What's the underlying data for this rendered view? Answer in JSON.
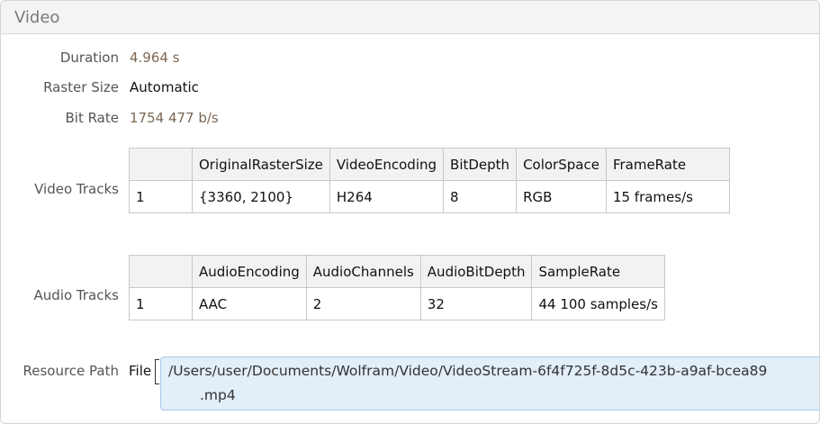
{
  "header": {
    "title": "Video"
  },
  "properties": {
    "duration": {
      "label": "Duration",
      "value": "4.964 s"
    },
    "raster_size": {
      "label": "Raster Size",
      "value": "Automatic"
    },
    "bit_rate": {
      "label": "Bit Rate",
      "value": "1754 477 b/s"
    }
  },
  "video_tracks": {
    "label": "Video Tracks",
    "columns": [
      "",
      "OriginalRasterSize",
      "VideoEncoding",
      "BitDepth",
      "ColorSpace",
      "FrameRate"
    ],
    "rows": [
      [
        "1",
        "{3360, 2100}",
        "H264",
        "8",
        "RGB",
        "15 frames/s"
      ]
    ]
  },
  "audio_tracks": {
    "label": "Audio Tracks",
    "columns": [
      "",
      "AudioEncoding",
      "AudioChannels",
      "AudioBitDepth",
      "SampleRate"
    ],
    "rows": [
      [
        "1",
        "AAC",
        "2",
        "32",
        "44 100 samples/s"
      ]
    ]
  },
  "resource_path": {
    "label": "Resource Path",
    "type_label": "File",
    "path_line1": "/Users/user/Documents/Wolfram/Video/VideoStream-6f4f725f-8d5c-423b-a9af-bcea89",
    "path_line2": ".mp4"
  }
}
